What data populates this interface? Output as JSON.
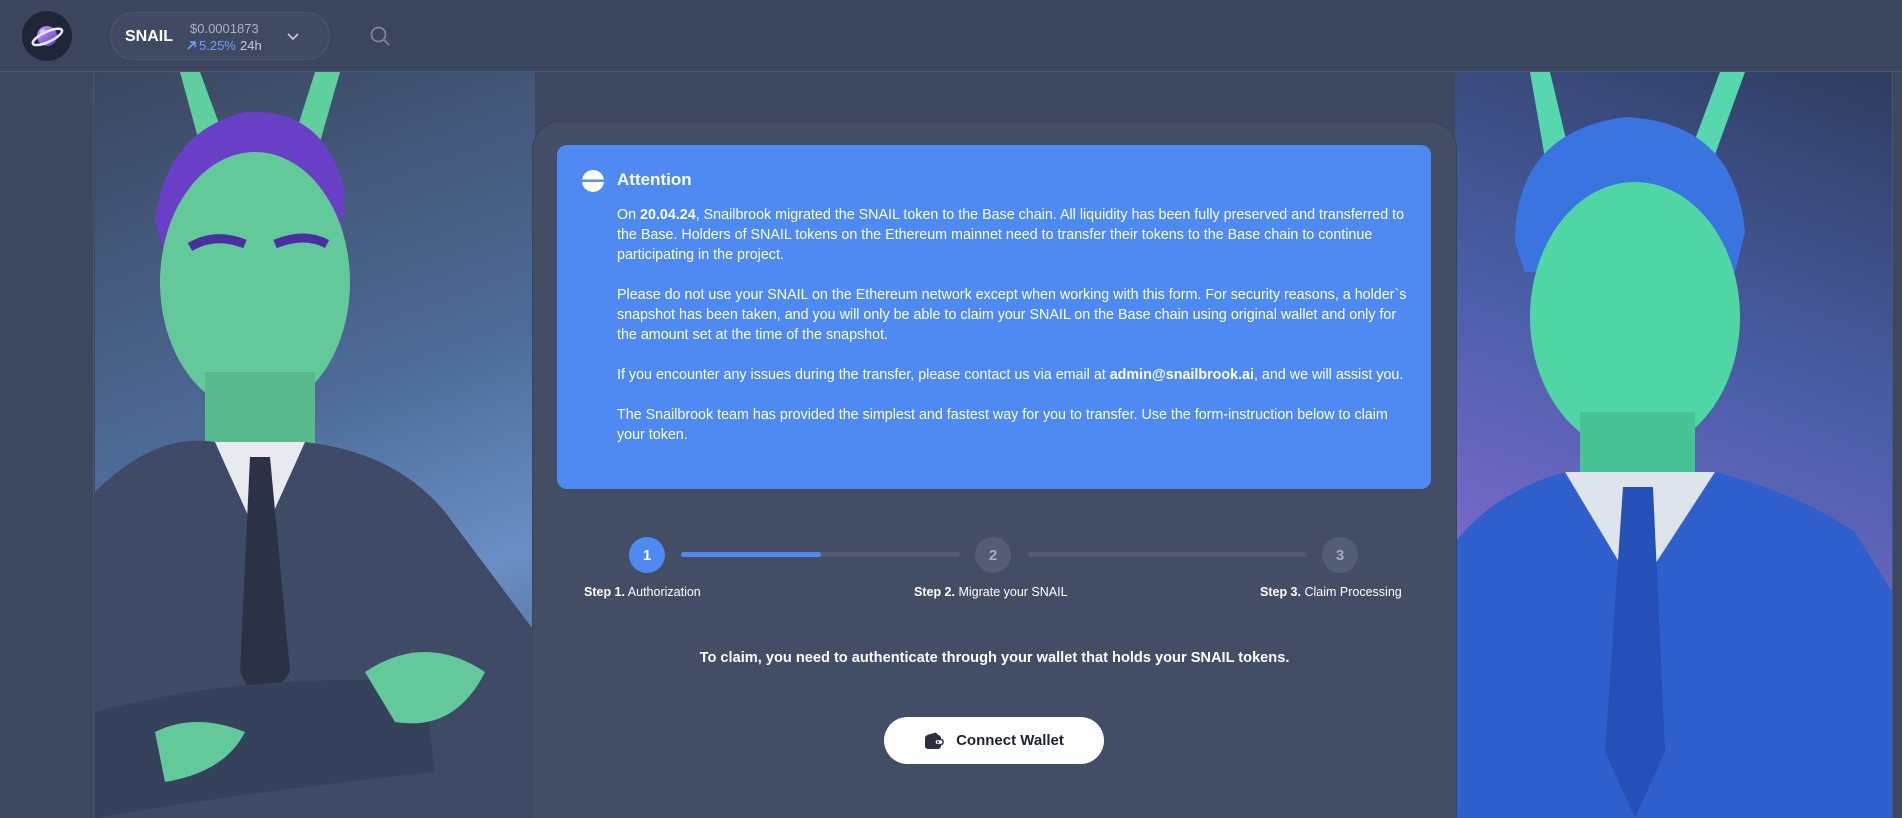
{
  "header": {
    "token_symbol": "SNAIL",
    "price": "$0.0001873",
    "change": "5.25%",
    "period": "24h"
  },
  "attention": {
    "title": "Attention",
    "p1_prefix": "On ",
    "p1_date": "20.04.24",
    "p1_rest": ", Snailbrook migrated the SNAIL token to the Base chain. All liquidity has been fully preserved and transferred to the Base. Holders of SNAIL tokens on the Ethereum mainnet need to transfer their tokens to the Base chain to continue participating in the project.",
    "p2": "Please do not use your SNAIL on the Ethereum network except when working with this form. For security reasons, a holder`s snapshot has been taken, and you will only be able to claim your SNAIL on the Base chain using original wallet and only for the amount set at the time of the snapshot.",
    "p3_prefix": "If you encounter any issues during the transfer, please contact us via email at ",
    "p3_email": "admin@snailbrook.ai",
    "p3_suffix": ", and we will assist you.",
    "p4": "The Snailbrook team has provided the simplest and fastest way for you to transfer. Use the form-instruction below to claim your token."
  },
  "stepper": {
    "progress": 0.5,
    "steps": [
      {
        "number": "1",
        "prefix": "Step 1.",
        "label": "Authorization",
        "active": true
      },
      {
        "number": "2",
        "prefix": "Step 2.",
        "label": "Migrate your SNAIL",
        "active": false
      },
      {
        "number": "3",
        "prefix": "Step 3.",
        "label": "Claim Processing",
        "active": false
      }
    ]
  },
  "claim": {
    "prefix": "To claim, you need to authenticate through your wallet that holds your ",
    "token": "SNAIL",
    "suffix": " tokens."
  },
  "connect_button": {
    "label": "Connect Wallet",
    "icon": "wallet-icon"
  },
  "colors": {
    "accent": "#4e8af2",
    "background": "#3d4760",
    "card": "#444d66",
    "positive_change": "#6ea0ff"
  }
}
